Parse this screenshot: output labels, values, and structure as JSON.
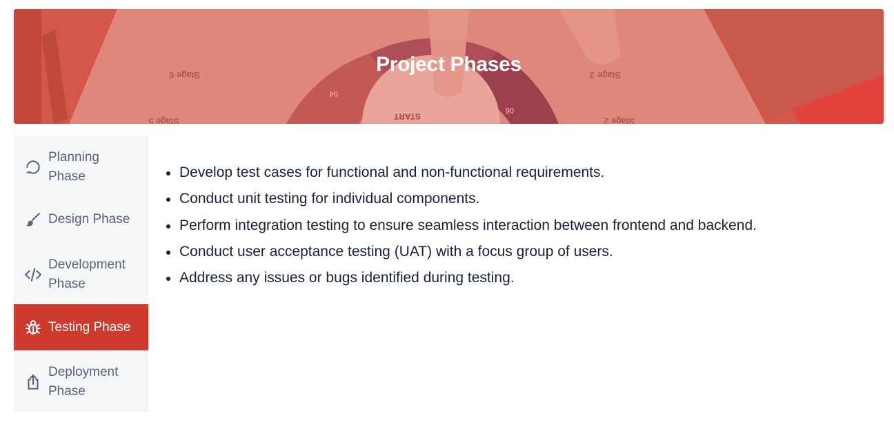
{
  "header": {
    "title": "Project Phases",
    "background_texts": [
      "Stage 6",
      "Stage 3",
      "04",
      "START",
      "06",
      "Stage 5",
      "Stage 2"
    ]
  },
  "sidebar": {
    "items": [
      {
        "label_line1": "Planning",
        "label_line2": "Phase",
        "icon": "refresh-arrows-icon",
        "active": false
      },
      {
        "label_line1": "Design Phase",
        "label_line2": "",
        "icon": "brush-icon",
        "active": false
      },
      {
        "label_line1": "Development",
        "label_line2": "Phase",
        "icon": "code-icon",
        "active": false
      },
      {
        "label_line1": "Testing Phase",
        "label_line2": "",
        "icon": "bug-icon",
        "active": true
      },
      {
        "label_line1": "Deployment",
        "label_line2": "Phase",
        "icon": "share-upload-icon",
        "active": false
      }
    ]
  },
  "content": {
    "items": [
      "Develop test cases for functional and non-functional requirements.",
      "Conduct unit testing for individual components.",
      "Perform integration testing to ensure seamless interaction between frontend and backend.",
      "Conduct user acceptance testing (UAT) with a focus group of users.",
      "Address any issues or bugs identified during testing."
    ]
  },
  "colors": {
    "accent": "#cf3a2e",
    "sidebar_bg": "#f4f6f8",
    "sidebar_text": "#55637a",
    "body_text": "#16213a"
  }
}
